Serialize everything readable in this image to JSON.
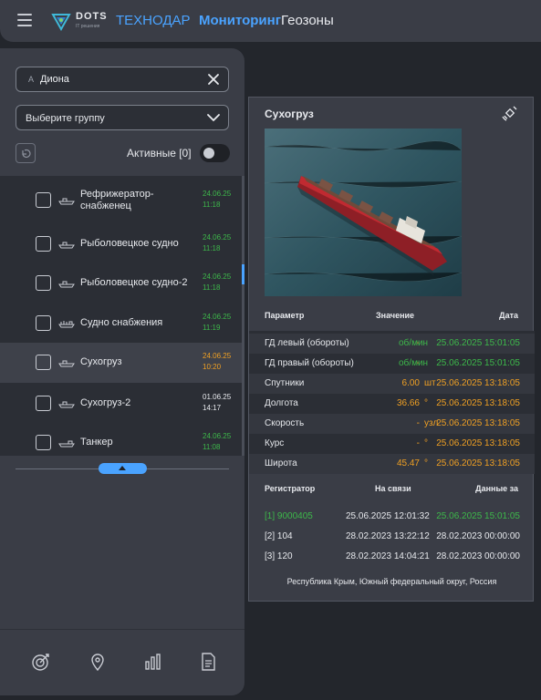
{
  "header": {
    "logo_text": "DOTS",
    "logo_sub": "IT решения",
    "brand": "ТЕХНОДАР",
    "nav": [
      {
        "label": "Мониторинг",
        "active": true
      },
      {
        "label": "Геозоны",
        "active": false
      }
    ]
  },
  "sidebar": {
    "search": {
      "prefix": "A",
      "value": "Диона"
    },
    "group_select": {
      "value": "Выберите группу"
    },
    "active_label": "Активные [0]",
    "vessels": [
      {
        "name": "Рефрижератор-снабженец",
        "date": "24.06.25",
        "time": "11:18",
        "status": "green"
      },
      {
        "name": "Рыболовецкое судно",
        "date": "24.06.25",
        "time": "11:18",
        "status": "green"
      },
      {
        "name": "Рыболовецкое судно-2",
        "date": "24.06.25",
        "time": "11:18",
        "status": "green"
      },
      {
        "name": "Судно снабжения",
        "date": "24.06.25",
        "time": "11:19",
        "status": "green"
      },
      {
        "name": "Сухогруз",
        "date": "24.06.25",
        "time": "10:20",
        "status": "orange"
      },
      {
        "name": "Сухогруз-2",
        "date": "01.06.25",
        "time": "14:17",
        "status": "white"
      },
      {
        "name": "Танкер",
        "date": "24.06.25",
        "time": "11:08",
        "status": "green"
      }
    ],
    "bottom_icons": [
      "target-icon",
      "location-pin-icon",
      "bar-chart-icon",
      "report-document-icon"
    ]
  },
  "card": {
    "title": "Сухогруз",
    "params_header": {
      "param": "Параметр",
      "value": "Значение",
      "date": "Дата"
    },
    "params": [
      {
        "name": "ГД левый (обороты)",
        "value": "-",
        "unit": "об/мин",
        "date": "25.06.2025 15:01:05",
        "color": "green"
      },
      {
        "name": "ГД правый (обороты)",
        "value": "-",
        "unit": "об/мин",
        "date": "25.06.2025 15:01:05",
        "color": "green"
      },
      {
        "name": "Спутники",
        "value": "6.00",
        "unit": "шт",
        "date": "25.06.2025 13:18:05",
        "color": "orange"
      },
      {
        "name": "Долгота",
        "value": "36.66",
        "unit": "°",
        "date": "25.06.2025 13:18:05",
        "color": "orange"
      },
      {
        "name": "Скорость",
        "value": "-",
        "unit": "узл",
        "date": "25.06.2025 13:18:05",
        "color": "orange"
      },
      {
        "name": "Курс",
        "value": "-",
        "unit": "°",
        "date": "25.06.2025 13:18:05",
        "color": "orange"
      },
      {
        "name": "Широта",
        "value": "45.47",
        "unit": "°",
        "date": "25.06.2025 13:18:05",
        "color": "orange"
      }
    ],
    "reg_header": {
      "reg": "Регистратор",
      "online": "На связи",
      "data": "Данные за"
    },
    "registrators": [
      {
        "id": "[1] 9000405",
        "online": "25.06.2025 12:01:32",
        "data": "25.06.2025 15:01:05",
        "color": "green"
      },
      {
        "id": "[2] 104",
        "online": "28.02.2023 13:22:12",
        "data": "28.02.2023 00:00:00",
        "color": "white"
      },
      {
        "id": "[3] 120",
        "online": "28.02.2023 14:04:21",
        "data": "28.02.2023 00:00:00",
        "color": "white"
      }
    ],
    "address": "Республика Крым, Южный федеральный округ, Россия"
  }
}
